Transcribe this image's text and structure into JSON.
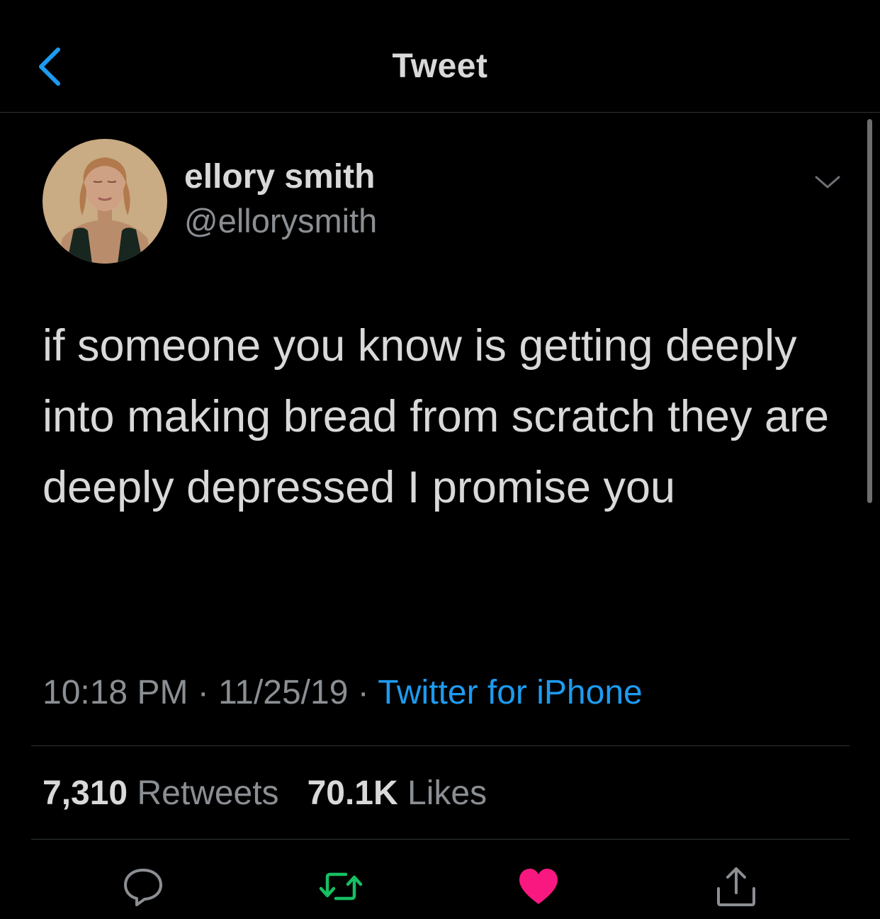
{
  "header": {
    "title": "Tweet",
    "back_icon": "chevron-left-icon"
  },
  "author": {
    "display_name": "ellory smith",
    "handle": "@ellorysmith"
  },
  "tweet": {
    "text": "if someone you know is getting deeply into making bread from scratch they are deeply depressed I promise you",
    "time": "10:18 PM",
    "separator": "·",
    "date": "11/25/19",
    "source": "Twitter for iPhone"
  },
  "stats": {
    "retweets_count": "7,310",
    "retweets_label": "Retweets",
    "likes_count": "70.1K",
    "likes_label": "Likes"
  },
  "actions": {
    "reply_icon": "reply-icon",
    "retweet_icon": "retweet-icon",
    "like_icon": "heart-icon",
    "share_icon": "share-icon"
  },
  "colors": {
    "background": "#000000",
    "text": "#d9d9d9",
    "muted": "#8b8f93",
    "link": "#1d9bf0",
    "retweet_active": "#17bf63",
    "like_active": "#f91880",
    "divider": "#2f3336"
  }
}
